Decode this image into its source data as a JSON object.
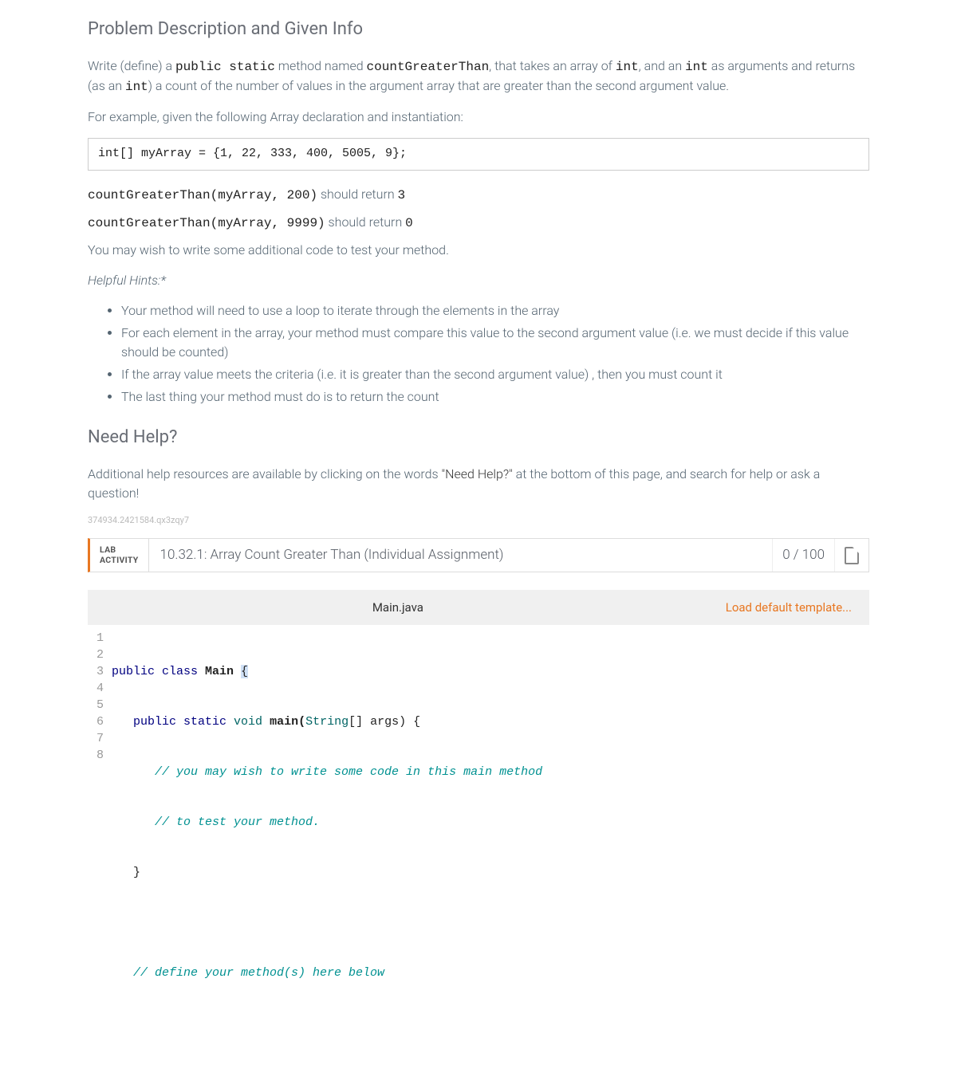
{
  "headings": {
    "problem": "Problem Description and Given Info",
    "need_help": "Need Help?"
  },
  "intro": {
    "pre1": "Write (define) a ",
    "code1": "public static",
    "mid1": " method named ",
    "code2": "countGreaterThan",
    "mid2": ", that takes an array of ",
    "code3": "int",
    "mid3": ", and an ",
    "code4": "int",
    "mid4": " as arguments and returns (as an ",
    "code5": "int",
    "post": ") a count of the number of values in the argument array that are greater than the second argument value."
  },
  "example_lead": "For example, given the following Array declaration and instantiation:",
  "code_sample": "int[] myArray = {1, 22, 333, 400, 5005, 9};",
  "examples": [
    {
      "call": "countGreaterThan(myArray, 200)",
      "mid": " should return ",
      "ret": "3"
    },
    {
      "call": "countGreaterThan(myArray, 9999)",
      "mid": " should return ",
      "ret": "0"
    }
  ],
  "extra_note": "You may wish to write some additional code to test your method.",
  "hints_label": "Helpful Hints:*",
  "hints": [
    "Your method will need to use a loop to iterate through the elements in the array",
    "For each element in the array, your method must compare this value to the second argument value (i.e. we must decide if this value should be counted)",
    "If the array value meets the criteria (i.e. it is greater than the second argument value) , then you must count it",
    "The last thing your method must do is to return the count"
  ],
  "help_text": {
    "pre": "Additional help resources are available by clicking on the words ",
    "quote": "\"Need Help?\"",
    "post": " at the bottom of this page, and search for help or ask a question!"
  },
  "activity_id": "374934.2421584.qx3zqy7",
  "lab": {
    "label_line1": "LAB",
    "label_line2": "ACTIVITY",
    "title": "10.32.1: Array Count Greater Than (Individual Assignment)",
    "score": "0 / 100"
  },
  "editor": {
    "filename": "Main.java",
    "load_template": "Load default template...",
    "code_tokens": {
      "l1_public": "public ",
      "l1_class": "class ",
      "l1_main": "Main ",
      "l1_brace": "{",
      "l2_indent": "   ",
      "l2_pubstatic": "public static ",
      "l2_void": "void ",
      "l2_mainfn": "main(",
      "l2_string": "String",
      "l2_rest": "[] args) {",
      "l3": "      // you may wish to write some code in this main method",
      "l4": "      // to test your method.",
      "l5": "   }",
      "l6": "",
      "l7": "   // define your method(s) here below",
      "l8": ""
    }
  }
}
